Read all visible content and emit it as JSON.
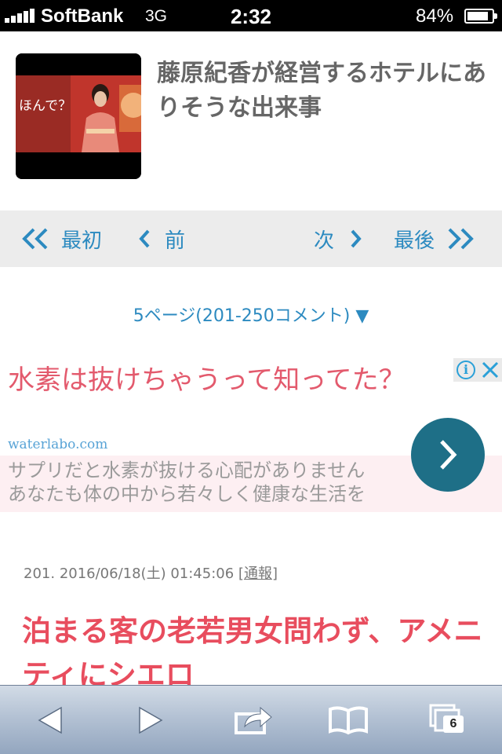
{
  "status_bar": {
    "carrier": "SoftBank",
    "network": "3G",
    "time": "2:32",
    "battery_percent": "84%",
    "battery_level": 0.84
  },
  "article": {
    "title": "藤原紀香が経営するホテルにありそうな出来事",
    "thumbnail_caption": "ほんで？"
  },
  "pager": {
    "first_label": "最初",
    "prev_label": "前",
    "next_label": "次",
    "last_label": "最後",
    "page_select": "5ページ(201-250コメント) ▼"
  },
  "ad": {
    "headline": "水素は抜けちゃうって知ってた？",
    "domain": "waterlabo.com",
    "body_line1": "サプリだと水素が抜ける心配がありません",
    "body_line2": "あなたも体の中から若々しく健康な生活を",
    "info_icon_text": "i"
  },
  "comment": {
    "number": "201.",
    "datetime": "2016/06/18(土) 01:45:06",
    "report_open": "[",
    "report_label": "通報",
    "report_close": "]",
    "text": "泊まる客の老若男女問わず、アメニティにシエロ"
  },
  "toolbar": {
    "tabs_count": "6"
  },
  "colors": {
    "link_blue": "#2c8ac0",
    "comment_red": "#e84d5e",
    "ad_pink": "#e35a6d",
    "ad_cta": "#1e6f87"
  }
}
